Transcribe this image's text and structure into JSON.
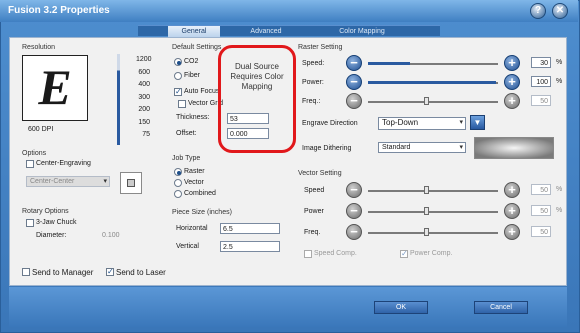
{
  "window": {
    "title": "Fusion 3.2 Properties",
    "help_icon": "?",
    "close_icon": "✕"
  },
  "tabs": [
    {
      "label": "General",
      "active": true
    },
    {
      "label": "Advanced",
      "active": false
    },
    {
      "label": "Color Mapping",
      "active": false
    }
  ],
  "resolution": {
    "label": "Resolution",
    "letter": "E",
    "dpi_label": "600 DPI",
    "values": [
      "1200",
      "600",
      "400",
      "300",
      "200",
      "150",
      "75"
    ]
  },
  "default_settings": {
    "label": "Default Settings",
    "co2": "CO2",
    "fiber": "Fiber",
    "auto_focus": "Auto Focus",
    "vector_grid": "Vector Grid",
    "thickness_label": "Thickness:",
    "thickness_value": "53",
    "offset_label": "Offset:",
    "offset_value": "0.000"
  },
  "callout": {
    "text": "Dual Source Requires Color Mapping"
  },
  "raster": {
    "header": "Raster Setting",
    "speed_label": "Speed:",
    "speed_value": "30",
    "power_label": "Power:",
    "power_value": "100",
    "freq_label": "Freq.:",
    "freq_value": "50",
    "pct": "%",
    "engrave_label": "Engrave Direction",
    "engrave_value": "Top-Down",
    "dithering_label": "Image Dithering",
    "dithering_value": "Standard"
  },
  "options": {
    "label": "Options",
    "center_engraving": "Center-Engraving",
    "center_value": "Center-Center"
  },
  "job_type": {
    "label": "Job Type",
    "raster": "Raster",
    "vector": "Vector",
    "combined": "Combined"
  },
  "piece_size": {
    "label": "Piece Size (inches)",
    "horizontal_label": "Horizontal",
    "horizontal_value": "6.5",
    "vertical_label": "Vertical",
    "vertical_value": "2.5"
  },
  "rotary": {
    "label": "Rotary Options",
    "chuck": "3-Jaw Chuck",
    "diameter_label": "Diameter:",
    "diameter_value": "0.100"
  },
  "vector": {
    "header": "Vector Setting",
    "speed_label": "Speed",
    "speed_value": "50",
    "power_label": "Power",
    "power_value": "50",
    "freq_label": "Freq.",
    "freq_value": "50",
    "pct": "%",
    "speed_comp": "Speed Comp.",
    "power_comp": "Power Comp."
  },
  "bottom": {
    "send_manager": "Send to Manager",
    "send_laser": "Send to Laser",
    "ok": "OK",
    "cancel": "Cancel"
  },
  "colors": {
    "accent": "#2f63a8",
    "callout": "#e1181b"
  }
}
